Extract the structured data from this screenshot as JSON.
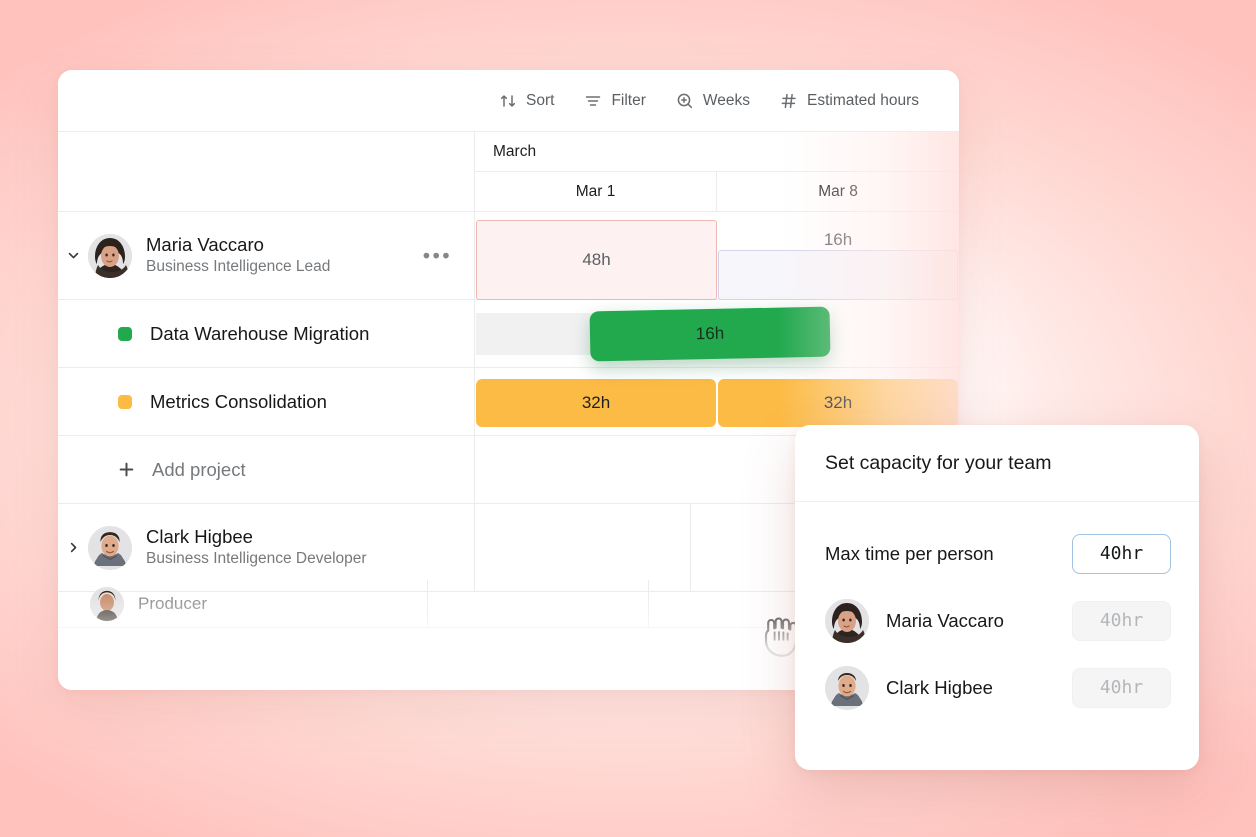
{
  "toolbar": {
    "items": [
      {
        "label": "Sort",
        "icon": "sort-icon"
      },
      {
        "label": "Filter",
        "icon": "filter-icon"
      },
      {
        "label": "Weeks",
        "icon": "zoom-in-icon"
      },
      {
        "label": "Estimated hours",
        "icon": "hash-icon"
      }
    ]
  },
  "timeline": {
    "month": "March",
    "weeks": [
      "Mar 1",
      "Mar 8"
    ]
  },
  "people": [
    {
      "name": "Maria Vaccaro",
      "role": "Business Intelligence Lead",
      "expanded_icon": "chevron-down-icon",
      "overflow_icon": "ellipsis-icon",
      "capacity": [
        {
          "value": "48h",
          "state": "over"
        },
        {
          "value": "16h",
          "state": "under"
        }
      ],
      "projects": [
        {
          "name": "Data Warehouse Migration",
          "color": "#22a94e",
          "bar": {
            "value": "16h",
            "dragging": true,
            "cursor": "grabbing-hand-icon"
          }
        },
        {
          "name": "Metrics Consolidation",
          "color": "#fcbb45",
          "bars": [
            {
              "value": "32h"
            },
            {
              "value": "32h"
            }
          ]
        }
      ],
      "add_project_label": "Add project",
      "add_project_icon": "plus-icon"
    },
    {
      "name": "Clark Higbee",
      "role": "Business Intelligence Developer",
      "collapsed_icon": "chevron-right-icon",
      "capacity": []
    }
  ],
  "partial_row": {
    "role": "Producer"
  },
  "popup": {
    "title": "Set capacity for your team",
    "max_time_label": "Max time per person",
    "max_time_value": "40hr",
    "members": [
      {
        "name": "Maria Vaccaro",
        "value": "40hr"
      },
      {
        "name": "Clark Higbee",
        "value": "40hr"
      }
    ]
  },
  "colors": {
    "green": "#22a94e",
    "orange": "#fcbb45",
    "over_capacity_border": "#f0b8b2",
    "under_capacity_border": "#d8d3ea",
    "background_pink": "#ffc9c4"
  }
}
